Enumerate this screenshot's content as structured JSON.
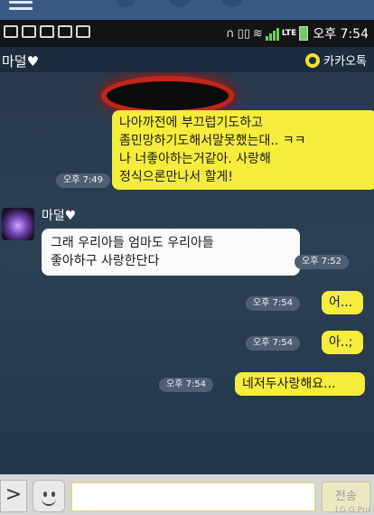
{
  "status_bar": {
    "time": "오후 7:54",
    "network": "LTE"
  },
  "header": {
    "title": "마덜♥",
    "brand": "카카오톡"
  },
  "messages": [
    {
      "sender": "me",
      "text": "나아까전에 부끄럽기도하고\n좀민망하기도해서말못했는대.. ㅋㅋ\n나 너좋아하는거같아. 사랑해\n정식으론만나서 할게!",
      "time": "오후 7:49"
    },
    {
      "sender": "other",
      "name": "마덜♥",
      "text": "그래 우리아들 엄마도 우리아들\n좋아하구 사랑한단다",
      "time": "오후 7:52"
    },
    {
      "sender": "me",
      "text": "어...",
      "time": "오후 7:54"
    },
    {
      "sender": "me",
      "text": "아..;",
      "time": "오후 7:54"
    },
    {
      "sender": "me",
      "text": "네저두사랑해요...",
      "time": "오후 7:54"
    }
  ],
  "input_bar": {
    "more_label": ">",
    "input_value": "",
    "send_label": "전송"
  },
  "watermark": "LG G Pro"
}
